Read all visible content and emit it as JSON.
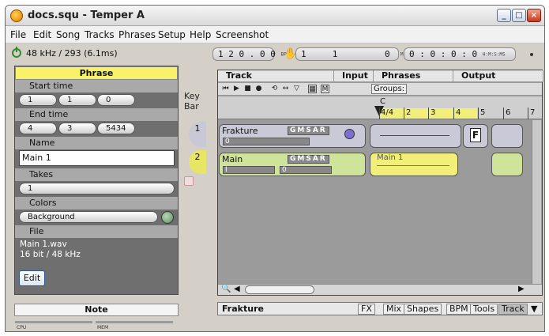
{
  "window": {
    "title": "docs.squ - Temper A"
  },
  "menu": [
    "File",
    "Edit",
    "Song",
    "Tracks",
    "Phrases",
    "Setup",
    "Help",
    "Screenshot"
  ],
  "status": {
    "rate": "48 kHz / 293 (6.1ms)",
    "bpm_value": "1 2 0 . 0 0",
    "bpm_unit": "BPM",
    "mbt_value": "1     1         0",
    "mbt_unit": "MBT",
    "hms_value": "0 : 0 : 0 : 0",
    "hms_unit": "H:M:S:MS"
  },
  "phrase_panel": {
    "header": "Phrase",
    "start_time_label": "Start time",
    "start_time": [
      "1",
      "1",
      "0"
    ],
    "end_time_label": "End time",
    "end_time": [
      "4",
      "3",
      "5434"
    ],
    "name_label": "Name",
    "name_value": "Main 1",
    "takes_label": "Takes",
    "takes_value": "1",
    "colors_label": "Colors",
    "color_value": "Background",
    "file_label": "File",
    "file_name": "Main 1.wav",
    "file_format": "16 bit / 48 kHz",
    "edit_label": "Edit"
  },
  "note_panel": {
    "header": "Note"
  },
  "meters": {
    "cpu": "CPU",
    "mem": "MEM"
  },
  "keybar": {
    "key": "Key",
    "bar": "Bar"
  },
  "arranger": {
    "headers": {
      "track": "Track",
      "input": "Input",
      "phrases": "Phrases",
      "output": "Output"
    },
    "groups_label": "Groups:",
    "marker": "C",
    "ruler": [
      "4/4",
      "2",
      "3",
      "4",
      "5",
      "6",
      "7"
    ],
    "gmsar": "GMSAR",
    "tracks": [
      {
        "num": "1",
        "name": "Frakture",
        "fader_a": "0",
        "fader_b": ""
      },
      {
        "num": "2",
        "name": "Main",
        "fader_a": "I",
        "fader_b": "0",
        "clip": "Main 1"
      }
    ],
    "output_label": "F"
  },
  "bottom": {
    "track_name": "Frakture",
    "tabs": [
      "FX",
      "Mix",
      "Shapes",
      "BPM",
      "Tools",
      "Track"
    ]
  },
  "colors": {
    "phrase_yellow": "#f7f26a",
    "track1": "#c9c9d8",
    "track2": "#cfe39a",
    "clip_yellow": "#f1ef7a"
  }
}
